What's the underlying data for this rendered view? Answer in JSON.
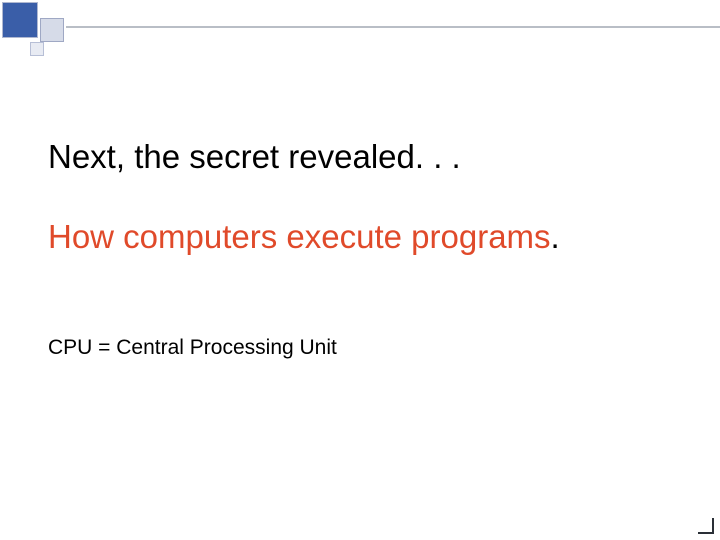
{
  "slide": {
    "line1": "Next, the secret revealed. . .",
    "line2_main": "How computers execute programs",
    "line2_period": ".",
    "line3": "CPU = Central Processing Unit"
  },
  "colors": {
    "accent_square": "#3a5ea8",
    "highlight_text": "#e04a2a"
  }
}
